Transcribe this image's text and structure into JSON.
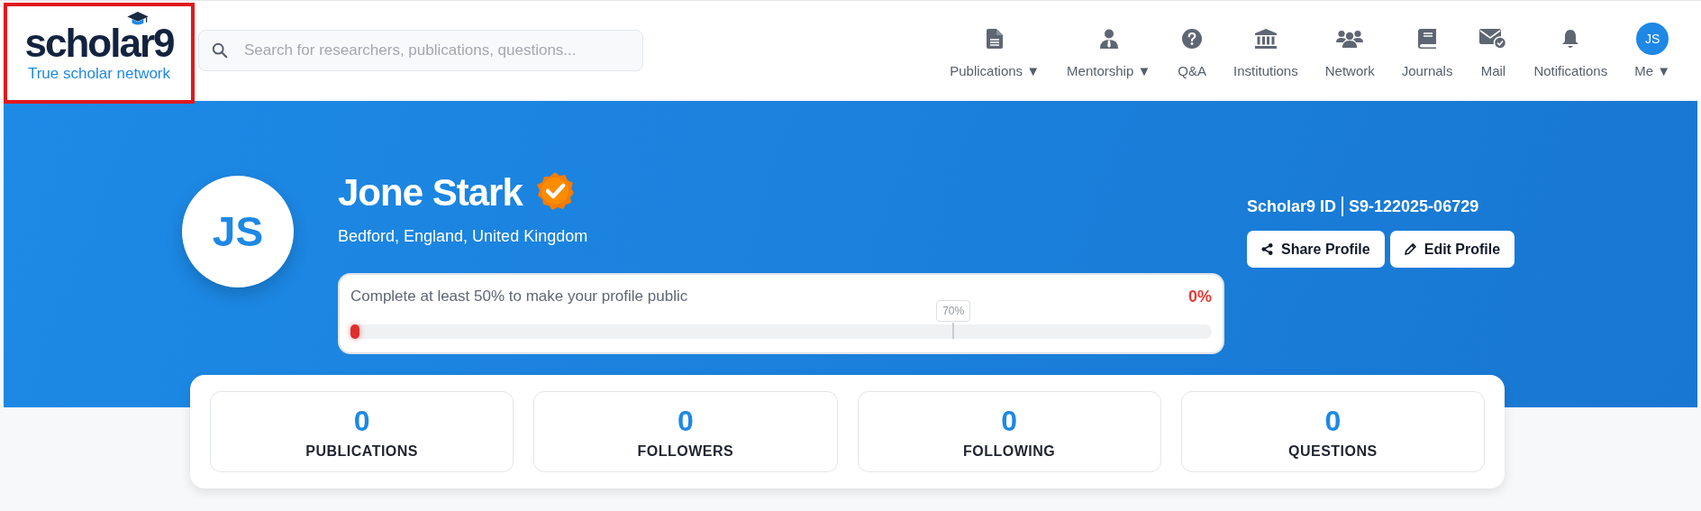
{
  "logo": {
    "name": "scholar9",
    "tagline": "True scholar network"
  },
  "search": {
    "placeholder": "Search for researchers, publications, questions..."
  },
  "nav": [
    {
      "kind": "doc",
      "label": "Publications",
      "caret": "▼"
    },
    {
      "kind": "mentor",
      "label": "Mentorship",
      "caret": "▼"
    },
    {
      "kind": "question",
      "label": "Q&A"
    },
    {
      "kind": "bank",
      "label": "Institutions"
    },
    {
      "kind": "people",
      "label": "Network"
    },
    {
      "kind": "book",
      "label": "Journals"
    },
    {
      "kind": "mail",
      "label": "Mail"
    },
    {
      "kind": "bell",
      "label": "Notifications"
    },
    {
      "kind": "avatar",
      "initials": "JS",
      "label": "Me",
      "caret": "▼"
    }
  ],
  "profile": {
    "initials": "JS",
    "name": "Jone Stark",
    "verified": true,
    "location": "Bedford, England, United Kingdom",
    "id_label": "Scholar9 ID",
    "id_value": "S9-122025-06729",
    "buttons": [
      {
        "kind": "share",
        "label": "Share Profile"
      },
      {
        "kind": "edit",
        "label": "Edit Profile"
      }
    ]
  },
  "completion": {
    "message": "Complete at least 50% to make your profile public",
    "percent": "0%",
    "level": 0,
    "marker_label": "70%"
  },
  "stats": [
    {
      "value": "0",
      "label": "PUBLICATIONS"
    },
    {
      "value": "0",
      "label": "FOLLOWERS"
    },
    {
      "value": "0",
      "label": "FOLLOWING"
    },
    {
      "value": "0",
      "label": "QUESTIONS"
    }
  ]
}
